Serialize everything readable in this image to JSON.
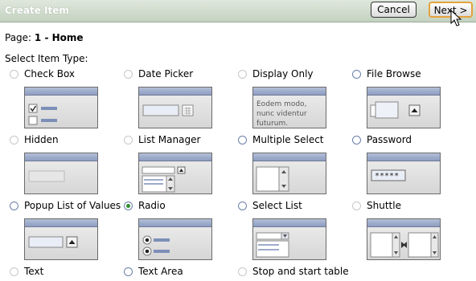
{
  "header": {
    "title": "Create Item",
    "cancel_label": "Cancel",
    "next_label": "Next >"
  },
  "page": {
    "label": "Page:",
    "value": "1 - Home"
  },
  "select_label": "Select Item Type:",
  "item_types": [
    {
      "label": "Check Box"
    },
    {
      "label": "Date Picker"
    },
    {
      "label": "Display Only",
      "preview_text": "Eodem modo, nunc videntur futurum."
    },
    {
      "label": "File Browse"
    },
    {
      "label": "Hidden"
    },
    {
      "label": "List Manager"
    },
    {
      "label": "Multiple Select"
    },
    {
      "label": "Password",
      "preview_text": "*****"
    },
    {
      "label": "Popup List of Values"
    },
    {
      "label": "Radio",
      "selected": true
    },
    {
      "label": "Select List"
    },
    {
      "label": "Shuttle"
    },
    {
      "label": "Text"
    },
    {
      "label": "Text Area"
    },
    {
      "label": "Stop and start table"
    }
  ]
}
